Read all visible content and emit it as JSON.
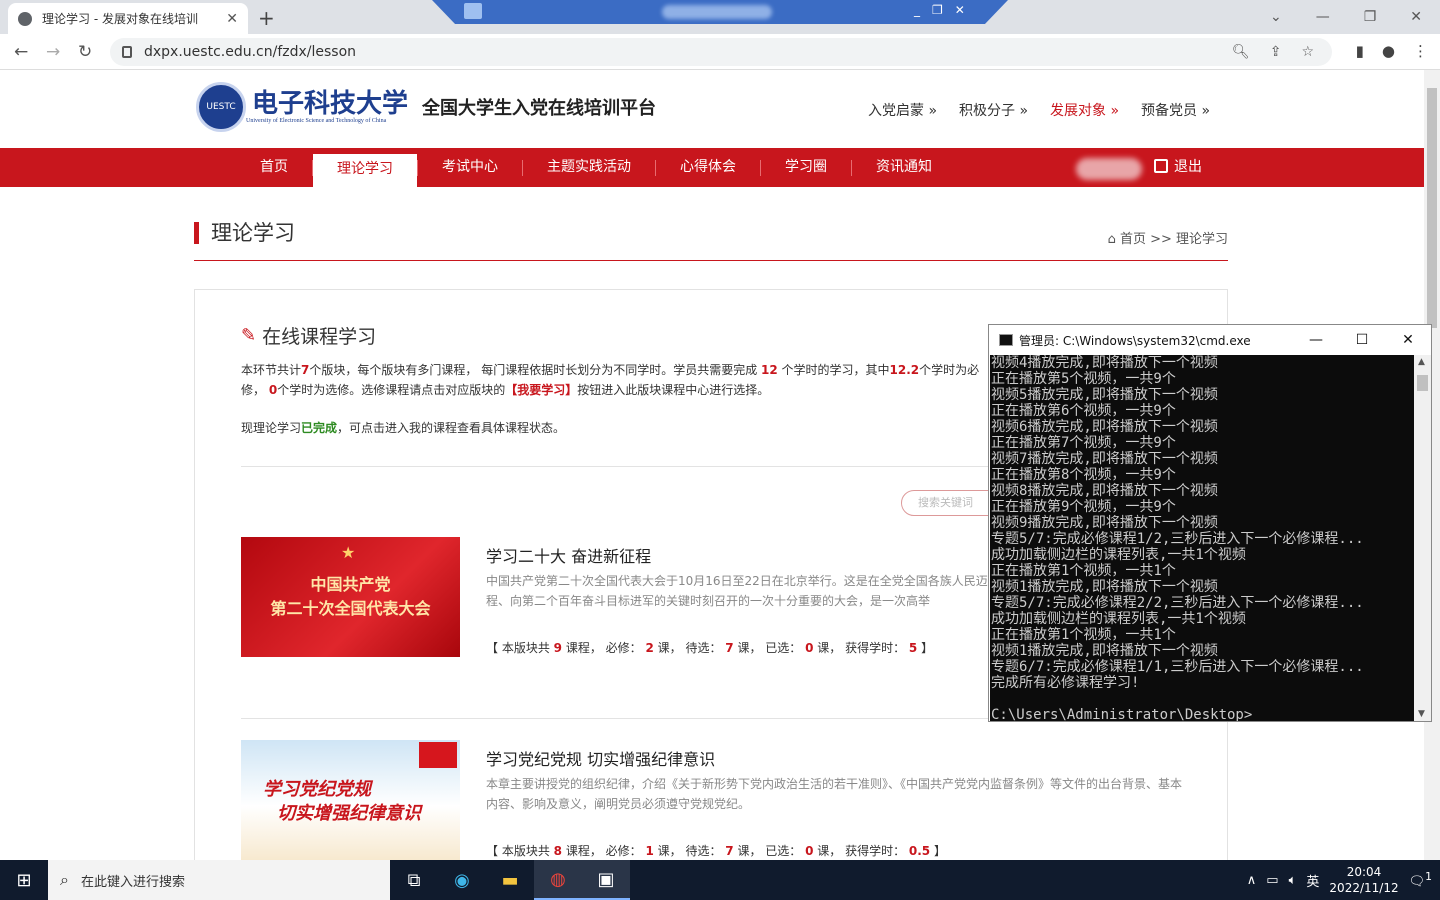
{
  "browser": {
    "tab_title": "理论学习 - 发展对象在线培训",
    "url": "dxpx.uestc.edu.cn/fzdx/lesson",
    "new_tab": "+",
    "close": "✕"
  },
  "window_controls": {
    "min": "⌄",
    "minimize": "—",
    "restore": "❐",
    "close": "✕"
  },
  "site": {
    "logo_cn": "电子科技大学",
    "logo_en": "University of Electronic Science and Technology of China",
    "logo_mark": "UESTC",
    "platform": "全国大学生入党在线培训平台",
    "stages": [
      "入党启蒙 »",
      "积极分子 »",
      "发展对象 »",
      "预备党员 »"
    ],
    "menu": [
      "首页",
      "理论学习",
      "考试中心",
      "主题实践活动",
      "心得体会",
      "学习圈",
      "资讯通知"
    ],
    "logout": "退出"
  },
  "section": {
    "title": "理论学习",
    "crumb": "⌂ 首页 >> 理论学习"
  },
  "box": {
    "heading": "在线课程学习",
    "intro1_a": "本环节共计",
    "intro1_n1": "7",
    "intro1_b": "个版块，每个版块有多门课程， 每门课程依据时长划分为不同学时。学员共需要完成 ",
    "intro1_n2": "12",
    "intro1_c": " 个学时的学习，其中",
    "intro1_n3": "12.2",
    "intro1_d": "个学时为必修， ",
    "intro1_n4": "0",
    "intro1_e": "个学时为选修。选修课程请点击对应版块的",
    "intro1_link": "【我要学习】",
    "intro1_f": "按钮进入此版块课程中心进行选择。",
    "intro2_a": "现理论学习",
    "intro2_done": "已完成",
    "intro2_b": "，可点击进入我的课程查看具体课程状态。",
    "search_placeholder": "搜索关键词"
  },
  "courses": [
    {
      "thumb_line1": "中国共产党",
      "thumb_line2": "第二十次全国代表大会",
      "title": "学习二十大 奋进新征程",
      "desc": "中国共产党第二十次全国代表大会于10月16日至22日在北京举行。这是在全党全国各族人民迈上全面建设社会主义现代化国家新征程、向第二个百年奋斗目标进军的关键时刻召开的一次十分重要的大会，是一次高举",
      "total": "9",
      "required": "2",
      "pending": "7",
      "selected": "0",
      "hours": "5"
    },
    {
      "thumb_line1": "学习党纪党规",
      "thumb_line2": "切实增强纪律意识",
      "title": "学习党纪党规 切实增强纪律意识",
      "desc": "本章主要讲授党的组织纪律，介绍《关于新形势下党内政治生活的若干准则》、《中国共产党党内监督条例》等文件的出台背景、基本内容、影响及意义，阐明党员必须遵守党规党纪。",
      "total": "8",
      "required": "1",
      "pending": "7",
      "selected": "0",
      "hours": "0.5"
    }
  ],
  "stat_labels": {
    "a": "【 本版块共 ",
    "b": " 课程， 必修： ",
    "c": " 课， 待选： ",
    "d": " 课， 已选： ",
    "e": " 课， 获得学时： ",
    "f": " 】"
  },
  "cmd": {
    "title": "管理员: C:\\Windows\\system32\\cmd.exe",
    "lines": "视频4播放完成,即将播放下一个视频\n正在播放第5个视频，一共9个\n视频5播放完成,即将播放下一个视频\n正在播放第6个视频，一共9个\n视频6播放完成,即将播放下一个视频\n正在播放第7个视频，一共9个\n视频7播放完成,即将播放下一个视频\n正在播放第8个视频，一共9个\n视频8播放完成,即将播放下一个视频\n正在播放第9个视频，一共9个\n视频9播放完成,即将播放下一个视频\n专题5/7:完成必修课程1/2,三秒后进入下一个必修课程...\n成功加载侧边栏的课程列表,一共1个视频\n正在播放第1个视频，一共1个\n视频1播放完成,即将播放下一个视频\n专题5/7:完成必修课程2/2,三秒后进入下一个必修课程...\n成功加载侧边栏的课程列表,一共1个视频\n正在播放第1个视频，一共1个\n视频1播放完成,即将播放下一个视频\n专题6/7:完成必修课程1/1,三秒后进入下一个必修课程...\n完成所有必修课程学习!\n\nC:\\Users\\Administrator\\Desktop>_"
  },
  "taskbar": {
    "search": "在此键入进行搜索",
    "ime": "英",
    "time": "20:04",
    "date": "2022/11/12",
    "notif": "1"
  }
}
